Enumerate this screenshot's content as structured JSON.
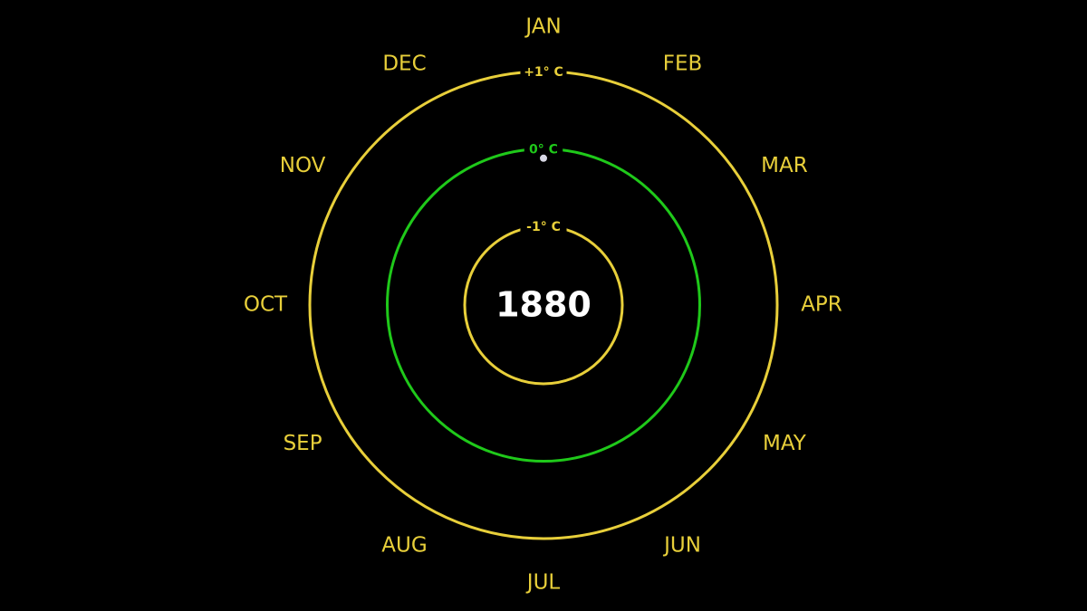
{
  "chart_data": {
    "type": "scatter",
    "year": "1880",
    "months": [
      "JAN",
      "FEB",
      "MAR",
      "APR",
      "MAY",
      "JUN",
      "JUL",
      "AUG",
      "SEP",
      "OCT",
      "NOV",
      "DEC"
    ],
    "rings": [
      {
        "value": -1,
        "label": "-1° C",
        "color": "#e8cf3a"
      },
      {
        "value": 0,
        "label": "0° C",
        "color": "#1fc91a"
      },
      {
        "value": 1,
        "label": "+1° C",
        "color": "#e8cf3a"
      }
    ],
    "points": [
      {
        "month": "JAN",
        "anomaly": -0.12
      }
    ],
    "rlim": [
      -1.5,
      1
    ],
    "colors": {
      "background": "#000000",
      "month_text": "#e8cf3a",
      "year_text": "#ffffff",
      "point": "#d8d8e4"
    },
    "grid": true,
    "legend": "none"
  }
}
